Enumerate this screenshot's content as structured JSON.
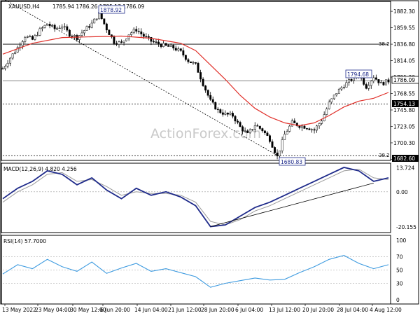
{
  "chart_data": [
    {
      "type": "candlestick",
      "panel": "price",
      "header": {
        "symbol": "XAUUSD,H4",
        "ohlc": "1785.94 1786.26 1785.17 1786.09"
      },
      "watermark": "ActionForex.com",
      "ylim": [
        1677,
        1895
      ],
      "y_ticks": [
        1882.3,
        1859.55,
        1836.8,
        1814.05,
        1791.3,
        1768.55,
        1745.8,
        1723.05,
        1700.3,
        1677.55
      ],
      "x_ticks": [
        "13 May 2022",
        "23 May 04:00",
        "30 May 12:00",
        "6 Jun 20:00",
        "14 Jun 04:00",
        "21 Jun 12:00",
        "28 Jun 20:00",
        "6 Jul 04:00",
        "13 Jul 12:00",
        "20 Jul 20:00",
        "28 Jul 04:00",
        "4 Aug 12:00"
      ],
      "price_path": [
        [
          0,
          1803
        ],
        [
          3,
          1818
        ],
        [
          6,
          1832
        ],
        [
          9,
          1848
        ],
        [
          12,
          1843
        ],
        [
          15,
          1856
        ],
        [
          18,
          1865
        ],
        [
          21,
          1858
        ],
        [
          24,
          1862
        ],
        [
          27,
          1851
        ],
        [
          30,
          1846
        ],
        [
          33,
          1856
        ],
        [
          36,
          1865
        ],
        [
          39,
          1879
        ],
        [
          42,
          1858
        ],
        [
          45,
          1840
        ],
        [
          48,
          1838
        ],
        [
          51,
          1851
        ],
        [
          54,
          1857
        ],
        [
          57,
          1848
        ],
        [
          60,
          1841
        ],
        [
          63,
          1837
        ],
        [
          66,
          1834
        ],
        [
          69,
          1832
        ],
        [
          72,
          1826
        ],
        [
          75,
          1814
        ],
        [
          78,
          1808
        ],
        [
          81,
          1782
        ],
        [
          84,
          1758
        ],
        [
          87,
          1745
        ],
        [
          90,
          1740
        ],
        [
          93,
          1738
        ],
        [
          96,
          1722
        ],
        [
          99,
          1712
        ],
        [
          102,
          1725
        ],
        [
          105,
          1718
        ],
        [
          108,
          1705
        ],
        [
          111,
          1681
        ],
        [
          114,
          1712
        ],
        [
          117,
          1728
        ],
        [
          120,
          1724
        ],
        [
          123,
          1722
        ],
        [
          126,
          1718
        ],
        [
          129,
          1732
        ],
        [
          132,
          1755
        ],
        [
          135,
          1770
        ],
        [
          138,
          1780
        ],
        [
          141,
          1788
        ],
        [
          144,
          1795
        ],
        [
          147,
          1778
        ],
        [
          150,
          1792
        ],
        [
          153,
          1782
        ],
        [
          156,
          1786
        ]
      ],
      "ma_path": [
        [
          0,
          1823
        ],
        [
          12,
          1838
        ],
        [
          24,
          1846
        ],
        [
          36,
          1847
        ],
        [
          48,
          1848
        ],
        [
          60,
          1845
        ],
        [
          72,
          1838
        ],
        [
          78,
          1828
        ],
        [
          84,
          1808
        ],
        [
          90,
          1788
        ],
        [
          96,
          1766
        ],
        [
          102,
          1748
        ],
        [
          108,
          1736
        ],
        [
          114,
          1728
        ],
        [
          120,
          1724
        ],
        [
          126,
          1728
        ],
        [
          132,
          1738
        ],
        [
          138,
          1750
        ],
        [
          144,
          1758
        ],
        [
          150,
          1762
        ],
        [
          156,
          1770
        ]
      ],
      "trendline": [
        [
          0,
          1900
        ],
        [
          111,
          1683
        ]
      ],
      "levels": [
        {
          "value": 1836.8,
          "label": "38.2",
          "style": "solid"
        },
        {
          "value": 1754.13,
          "style": "dashed"
        },
        {
          "value": 1786.09,
          "style": "solid"
        },
        {
          "value": 1682.6,
          "label": "38.2",
          "style": "dashed"
        }
      ],
      "price_badges": [
        "1754.13",
        "1786.09",
        "1682.60"
      ],
      "callouts": [
        "1878.92",
        "1794.68",
        "1680.83"
      ]
    },
    {
      "type": "line",
      "panel": "macd",
      "header": "MACD(12,26,9) 4.820 4.256",
      "ylim": [
        -23,
        16
      ],
      "y_ticks": [
        "13.724",
        "0.00",
        "-20.155"
      ],
      "series": [
        {
          "values": [
            [
              0,
              -4
            ],
            [
              6,
              2
            ],
            [
              12,
              6
            ],
            [
              18,
              12
            ],
            [
              24,
              10
            ],
            [
              30,
              4
            ],
            [
              36,
              8
            ],
            [
              42,
              1
            ],
            [
              48,
              -4
            ],
            [
              54,
              2
            ],
            [
              60,
              -2
            ],
            [
              66,
              0
            ],
            [
              72,
              -3
            ],
            [
              78,
              -8
            ],
            [
              84,
              -20
            ],
            [
              90,
              -19
            ],
            [
              96,
              -14
            ],
            [
              102,
              -9
            ],
            [
              108,
              -6
            ],
            [
              114,
              -2
            ],
            [
              120,
              2
            ],
            [
              126,
              6
            ],
            [
              132,
              10
            ],
            [
              138,
              14
            ],
            [
              144,
              12
            ],
            [
              150,
              6
            ],
            [
              156,
              8
            ]
          ]
        },
        {
          "values": [
            [
              0,
              -6
            ],
            [
              6,
              0
            ],
            [
              12,
              4
            ],
            [
              18,
              10
            ],
            [
              24,
              11
            ],
            [
              30,
              6
            ],
            [
              36,
              7
            ],
            [
              42,
              3
            ],
            [
              48,
              -2
            ],
            [
              54,
              0
            ],
            [
              60,
              -1
            ],
            [
              66,
              -1
            ],
            [
              72,
              -2
            ],
            [
              78,
              -6
            ],
            [
              84,
              -17
            ],
            [
              90,
              -19
            ],
            [
              96,
              -16
            ],
            [
              102,
              -11
            ],
            [
              108,
              -8
            ],
            [
              114,
              -4
            ],
            [
              120,
              0
            ],
            [
              126,
              4
            ],
            [
              132,
              8
            ],
            [
              138,
              12
            ],
            [
              144,
              13
            ],
            [
              150,
              8
            ],
            [
              156,
              7
            ]
          ]
        }
      ],
      "trendline": [
        [
          84,
          -20
        ],
        [
          150,
          5
        ]
      ]
    },
    {
      "type": "line",
      "panel": "rsi",
      "header": "RSI(14) 57.7000",
      "ylim": [
        0,
        100
      ],
      "y_ticks": [
        "100",
        "70",
        "50",
        "30",
        "0"
      ],
      "series": [
        {
          "values": [
            [
              0,
              44
            ],
            [
              6,
              58
            ],
            [
              12,
              52
            ],
            [
              18,
              66
            ],
            [
              24,
              55
            ],
            [
              30,
              48
            ],
            [
              36,
              62
            ],
            [
              42,
              45
            ],
            [
              48,
              53
            ],
            [
              54,
              60
            ],
            [
              60,
              48
            ],
            [
              66,
              52
            ],
            [
              72,
              46
            ],
            [
              78,
              40
            ],
            [
              84,
              24
            ],
            [
              90,
              30
            ],
            [
              96,
              34
            ],
            [
              102,
              38
            ],
            [
              108,
              35
            ],
            [
              114,
              36
            ],
            [
              120,
              46
            ],
            [
              126,
              55
            ],
            [
              132,
              66
            ],
            [
              138,
              72
            ],
            [
              144,
              60
            ],
            [
              150,
              52
            ],
            [
              156,
              58
            ]
          ]
        }
      ],
      "ref_lines": [
        70,
        50,
        30
      ]
    }
  ]
}
